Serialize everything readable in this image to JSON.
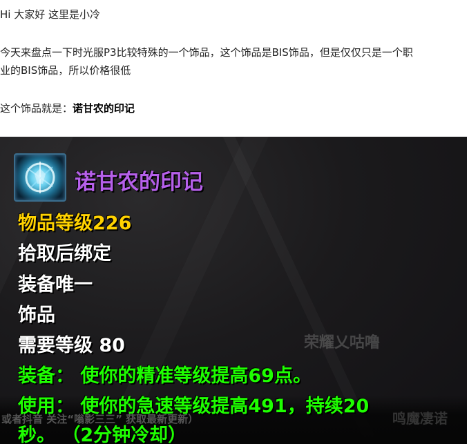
{
  "article": {
    "greeting": "Hi 大家好 这里是小冷",
    "intro_line1": "今天来盘点一下时光服P3比较特殊的一个饰品，这个饰品是BIS饰品，但是仅仅只是一个职",
    "intro_line2": "业的BIS饰品，所以价格很低",
    "item_intro_prefix": "这个饰品就是：",
    "item_intro_name": "诺甘农的印记"
  },
  "tooltip": {
    "icon": "rune-sphere-icon",
    "item_name": "诺甘农的印记",
    "item_level": "物品等级226",
    "bind": "拾取后绑定",
    "unique": "装备唯一",
    "slot": "饰品",
    "required_level": "需要等级 80",
    "equip_effect": "装备： 使你的精准等级提高69点。",
    "use_effect_line1": "使用： 使你的急速等级提高491，持续20",
    "use_effect_line2": "秒。 （2分钟冷却）",
    "colors": {
      "item_name": "#b660ea",
      "item_level": "#ffd200",
      "base": "#ffffff",
      "effect": "#1eff00"
    }
  },
  "watermarks": {
    "right": "荣耀乂咕噜",
    "bottom": "或者抖音 关注“嗡影三三” 获取最新更新）",
    "corner": "鸣魔凄诺"
  }
}
